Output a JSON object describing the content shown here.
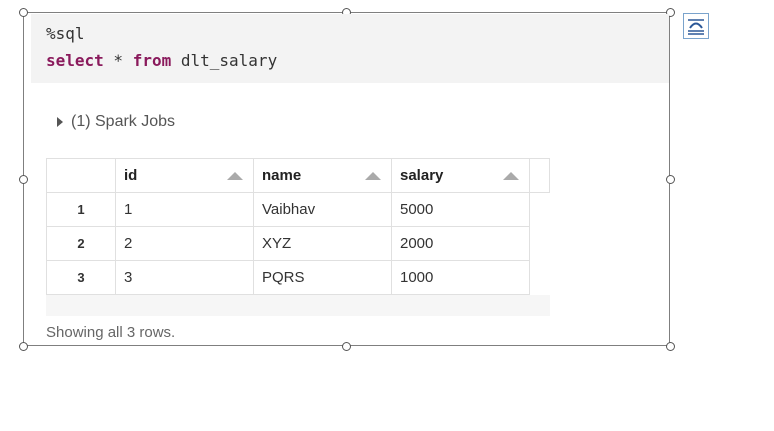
{
  "code": {
    "magic": "%sql",
    "keyword1": "select",
    "star": " * ",
    "keyword2": "from",
    "table_name": " dlt_salary"
  },
  "jobs": {
    "label": "(1) Spark Jobs"
  },
  "table": {
    "columns": [
      "id",
      "name",
      "salary"
    ],
    "rows": [
      {
        "num": "1",
        "id": "1",
        "name": "Vaibhav",
        "salary": "5000"
      },
      {
        "num": "2",
        "id": "2",
        "name": "XYZ",
        "salary": "2000"
      },
      {
        "num": "3",
        "id": "3",
        "name": "PQRS",
        "salary": "1000"
      }
    ]
  },
  "footer": {
    "text": "Showing all 3 rows."
  },
  "icons": {
    "layout_options": "layout-options-icon",
    "expand": "expand-triangle-icon",
    "sort": "sort-ascending-icon"
  }
}
